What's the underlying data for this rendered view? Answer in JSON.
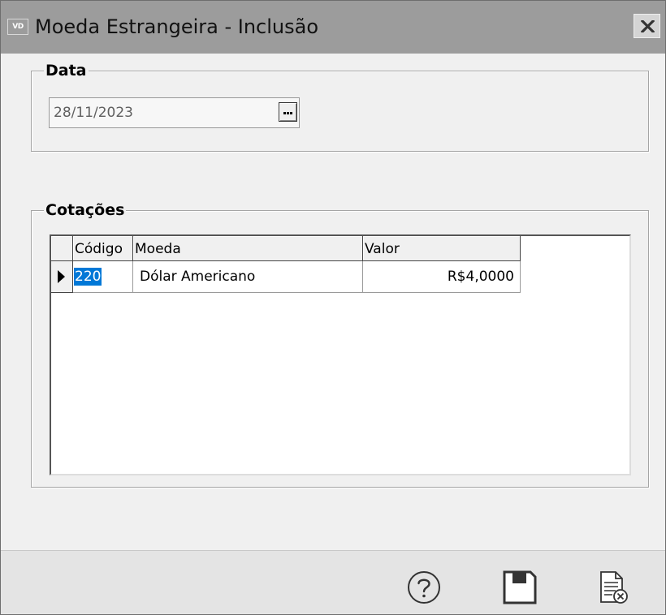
{
  "window": {
    "title": "Moeda Estrangeira - Inclusão",
    "app_icon_text": "VD"
  },
  "data_group": {
    "legend": "Data",
    "date_value": "28/11/2023"
  },
  "cotacoes_group": {
    "legend": "Cotações",
    "columns": [
      "Código",
      "Moeda",
      "Valor"
    ],
    "rows": [
      {
        "codigo": "220",
        "moeda": "Dólar Americano",
        "valor": "R$4,0000"
      }
    ]
  },
  "footer": {
    "buttons": [
      "help-icon",
      "save-icon",
      "cancel-document-icon"
    ]
  },
  "colors": {
    "titlebar": "#9c9c9c",
    "selection": "#0078d7",
    "window_bg": "#f0f0f0"
  }
}
